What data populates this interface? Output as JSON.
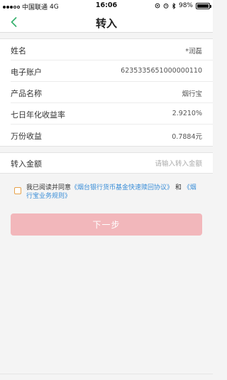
{
  "status_bar": {
    "carrier": "中国联通",
    "network": "4G",
    "time": "16:06",
    "battery": "98%",
    "battery_level": 0.98
  },
  "nav": {
    "title": "转入",
    "back_icon": "chevron-left-icon",
    "back_color": "#3cb371"
  },
  "info": {
    "rows": [
      {
        "label": "姓名",
        "value": "*润磊"
      },
      {
        "label": "电子账户",
        "value": "6235335651000000110"
      },
      {
        "label": "产品名称",
        "value": "烟行宝"
      },
      {
        "label": "七日年化收益率",
        "value": "2.9210%"
      },
      {
        "label": "万份收益",
        "value": "0.7884元"
      }
    ]
  },
  "amount": {
    "label": "转入金额",
    "placeholder": "请输入转入金额",
    "value": ""
  },
  "agreement": {
    "prefix": "我已阅读并同意",
    "link1": "《烟台银行货币基金快速赎回协议》",
    "middle": "和",
    "link2": "《烟行宝业务规则》",
    "checked": false,
    "link_color": "#3a8ed8"
  },
  "next_button": {
    "label": "下一步",
    "color": "#f2b7bb"
  }
}
